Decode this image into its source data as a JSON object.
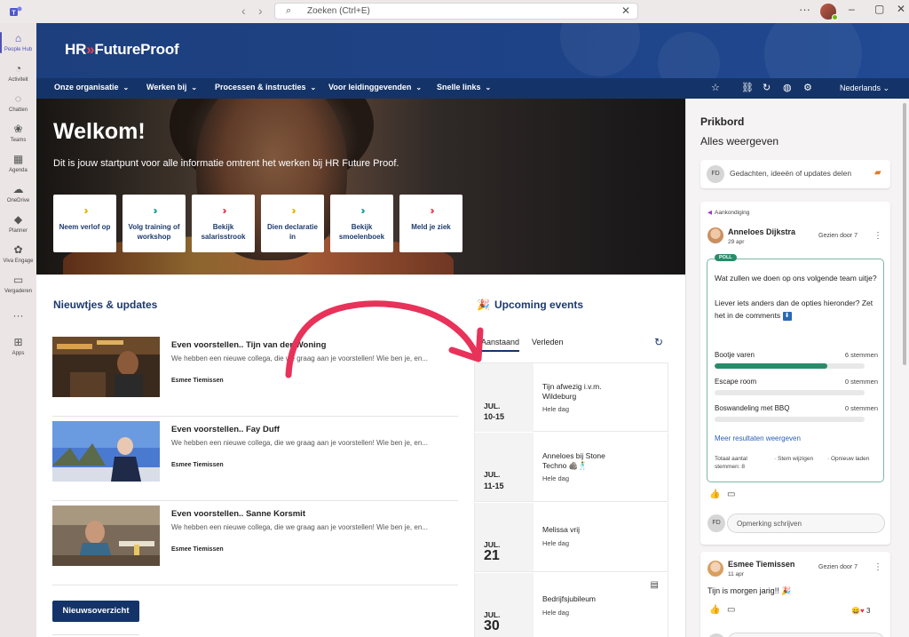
{
  "window": {
    "search_placeholder": "Zoeken (Ctrl+E)",
    "more": "···",
    "minimize": "–",
    "maximize": "▢",
    "close": "✕"
  },
  "rail": {
    "items": [
      {
        "label": "People Hub",
        "icon": "home-icon",
        "glyph": "⌂"
      },
      {
        "label": "Activiteit",
        "icon": "bell-icon",
        "glyph": "🔔"
      },
      {
        "label": "Chatten",
        "icon": "chat-icon",
        "glyph": "💬"
      },
      {
        "label": "Teams",
        "icon": "teams-icon",
        "glyph": "👥"
      },
      {
        "label": "Agenda",
        "icon": "calendar-icon",
        "glyph": "📅"
      },
      {
        "label": "OneDrive",
        "icon": "cloud-icon",
        "glyph": "☁"
      },
      {
        "label": "Planner",
        "icon": "planner-icon",
        "glyph": "◆"
      },
      {
        "label": "Viva Engage",
        "icon": "engage-icon",
        "glyph": "❋"
      },
      {
        "label": "Vergaderen",
        "icon": "video-icon",
        "glyph": "▭"
      }
    ],
    "more": "···",
    "apps_label": "Apps"
  },
  "header": {
    "logo_prefix": "HR",
    "logo_chevrons": "»",
    "logo_suffix": "FutureProof"
  },
  "nav": {
    "items": [
      "Onze organisatie",
      "Werken bij",
      "Processen & instructies",
      "Voor leidinggevenden",
      "Snelle links"
    ],
    "language": "Nederlands"
  },
  "hero": {
    "title": "Welkom!",
    "subtitle": "Dit is jouw startpunt voor alle informatie omtrent het werken bij HR Future Proof.",
    "quicklinks": [
      {
        "label": "Neem verlof op",
        "color": "#e8b800"
      },
      {
        "label": "Volg training of workshop",
        "color": "#1fa5a0"
      },
      {
        "label": "Bekijk salarisstrook",
        "color": "#e8445a"
      },
      {
        "label": "Dien declaratie in",
        "color": "#e8b800"
      },
      {
        "label": "Bekijk smoelenboek",
        "color": "#1fa5a0"
      },
      {
        "label": "Meld je ziek",
        "color": "#e8445a"
      }
    ]
  },
  "news": {
    "title": "Nieuwtjes & updates",
    "items": [
      {
        "title": "Even voorstellen.. Tijn van der Woning",
        "excerpt": "We hebben een nieuwe collega, die we graag aan je voorstellen! Wie ben je, en...",
        "author": "Esmee Tiemissen"
      },
      {
        "title": "Even voorstellen.. Fay Duff",
        "excerpt": "We hebben een nieuwe collega, die we graag aan je voorstellen! Wie ben je, en...",
        "author": "Esmee Tiemissen"
      },
      {
        "title": "Even voorstellen.. Sanne Korsmit",
        "excerpt": "We hebben een nieuwe collega, die we graag aan je voorstellen! Wie ben je, en...",
        "author": "Esmee Tiemissen"
      }
    ],
    "button": "Nieuwsoverzicht"
  },
  "events": {
    "title": "Upcoming events",
    "tabs": [
      "Aanstaand",
      "Verleden"
    ],
    "items": [
      {
        "month": "JUL.",
        "day": "10-15",
        "title": "Tijn afwezig i.v.m. Wildeburg",
        "sub": "Hele dag"
      },
      {
        "month": "JUL.",
        "day": "11-15",
        "title": "Anneloes bij Stone Techno 🪨🕺",
        "sub": "Hele dag"
      },
      {
        "month": "JUL.",
        "day": "21",
        "title": "Melissa vrij",
        "sub": "Hele dag"
      },
      {
        "month": "JUL.",
        "day": "30",
        "title": "Bedrijfsjubileum",
        "sub": "Hele dag"
      }
    ]
  },
  "prikbord": {
    "title": "Prikbord",
    "view_all": "Alles weergeven",
    "composer_initials": "FD",
    "composer_placeholder": "Gedachten, ideeën of updates delen",
    "post1": {
      "tag": "Aankondiging",
      "author": "Anneloes Dijkstra",
      "date": "29 apr",
      "seen": "Gezien door 7",
      "poll_badge": "POLL",
      "question": "Wat zullen we doen op ons volgende team uitje?",
      "question_note": "Liever iets anders dan de opties hieronder?  Zet het in de comments",
      "options": [
        {
          "label": "Bootje varen",
          "votes_text": "6 stemmen",
          "share": 0.75
        },
        {
          "label": "Escape room",
          "votes_text": "0 stemmen",
          "share": 0
        },
        {
          "label": "Boswandeling met BBQ",
          "votes_text": "0 stemmen",
          "share": 0
        }
      ],
      "more_results": "Meer resultaten weergeven",
      "total_votes": "Totaal aantal stemmen: 8",
      "change_vote": "Stem wijzigen",
      "reload": "Opnieuw laden",
      "comment_placeholder": "Opmerking schrijven"
    },
    "post2": {
      "author": "Esmee Tiemissen",
      "date": "11 apr",
      "seen": "Gezien door 7",
      "text": "Tijn is morgen jarig!! 🎉",
      "reaction_count": "3"
    }
  }
}
